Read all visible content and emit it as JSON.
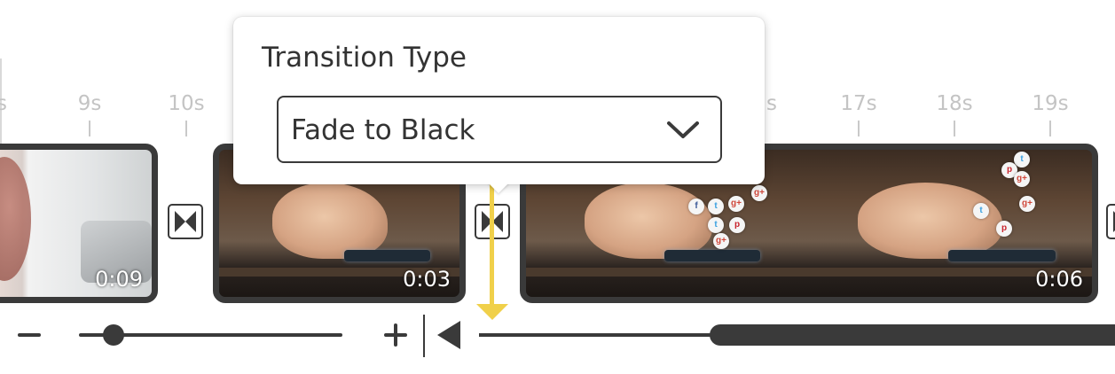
{
  "ruler": {
    "ticks": [
      "s",
      "9s",
      "10s",
      "s",
      "17s",
      "18s",
      "19s"
    ]
  },
  "clips": [
    {
      "duration": "0:09"
    },
    {
      "duration": "0:03"
    },
    {
      "duration": "0:06"
    }
  ],
  "social_icons": {
    "twitter": "t",
    "google_plus": "g+",
    "facebook": "f",
    "pinterest": "p"
  },
  "transition_popover": {
    "title": "Transition Type",
    "selected": "Fade to Black"
  },
  "colors": {
    "playhead": "#f0d04a",
    "clip_border": "#3a3a3a",
    "ruler_text": "#c4c4c4"
  },
  "icons": {
    "transition": "bowtie-transition-icon",
    "dropdown": "chevron-down-icon",
    "zoom_out": "minus-icon",
    "zoom_in": "plus-icon",
    "scroll_left": "triangle-left-icon"
  }
}
